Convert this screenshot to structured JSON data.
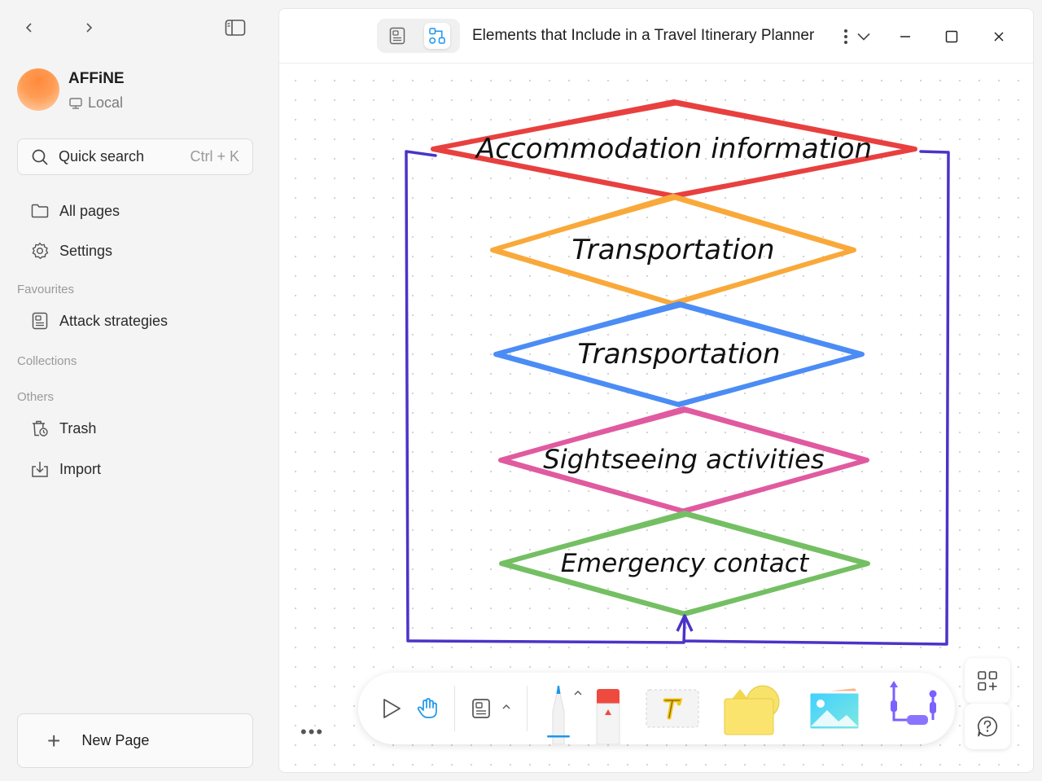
{
  "sidebar": {
    "workspace": {
      "name": "AFFiNE",
      "storage": "Local"
    },
    "search": {
      "label": "Quick search",
      "shortcut": "Ctrl + K"
    },
    "nav": [
      {
        "label": "All pages",
        "icon": "folder-icon"
      },
      {
        "label": "Settings",
        "icon": "gear-icon"
      }
    ],
    "favourites_heading": "Favourites",
    "favourites": [
      {
        "label": "Attack strategies",
        "icon": "page-icon"
      }
    ],
    "collections_heading": "Collections",
    "others_heading": "Others",
    "others": [
      {
        "label": "Trash",
        "icon": "trash-icon"
      },
      {
        "label": "Import",
        "icon": "import-icon"
      }
    ],
    "new_page": "New Page"
  },
  "header": {
    "title": "Elements that Include in a Travel Itinerary Planner",
    "modes": [
      "page-mode-icon",
      "edgeless-mode-icon"
    ],
    "active_mode": "edgeless"
  },
  "canvas": {
    "diamonds": [
      {
        "label": "Accommodation information",
        "color": "#e8403f"
      },
      {
        "label": "Transportation",
        "color": "#f9a93a"
      },
      {
        "label": "Transportation",
        "color": "#4b8cf5"
      },
      {
        "label": "Sightseeing activities",
        "color": "#e05aa0"
      },
      {
        "label": "Emergency contact",
        "color": "#74bf63"
      }
    ],
    "loop_color": "#4a34c8"
  },
  "toolbar": {
    "tools": [
      "select-icon",
      "hand-icon",
      "note-icon",
      "pen-icon",
      "eraser-icon",
      "text-icon",
      "shape-icon",
      "image-icon",
      "connector-icon"
    ]
  },
  "colors": {
    "accent": "#1e96eb"
  }
}
